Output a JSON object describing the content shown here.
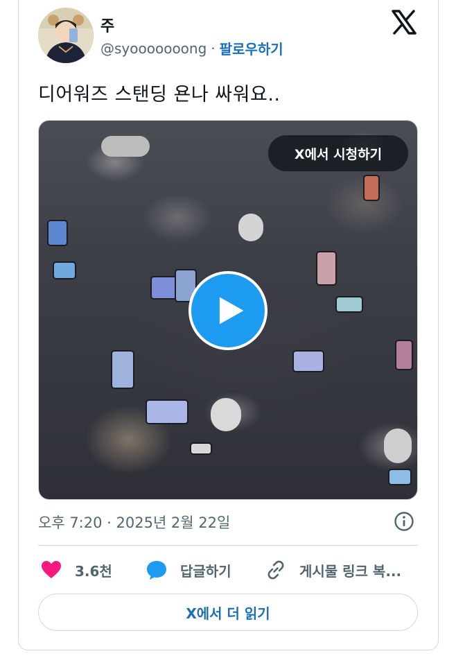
{
  "author": {
    "name": "주",
    "handle": "@syooooooong",
    "separator": "·",
    "follow_label": "팔로우하기"
  },
  "tweet": {
    "text": "디어워즈 스탠딩 욘나 싸워요..",
    "timestamp": "오후 7:20 · 2025년 2월 22일"
  },
  "media": {
    "watch_label": "X에서 시청하기",
    "play_icon": "play-icon"
  },
  "actions": {
    "like_count": "3.6천",
    "reply_label": "답글하기",
    "copy_link_label": "게시물 링크 복..."
  },
  "read_more_label": "X에서 더 읽기",
  "colors": {
    "accent": "#1d9bf0",
    "like": "#f91880",
    "link": "#1a6fb8",
    "muted": "#536471",
    "border": "#cfd9de"
  }
}
